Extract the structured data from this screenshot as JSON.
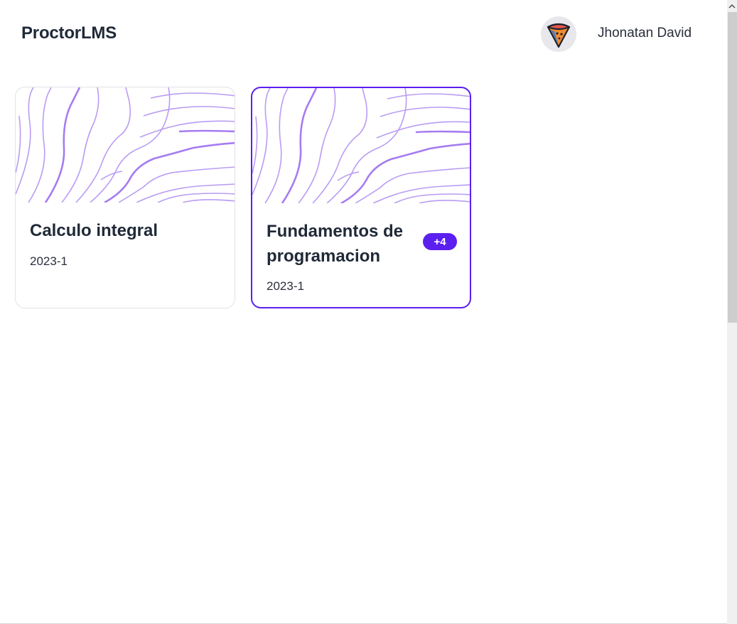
{
  "app": {
    "brand": "ProctorLMS"
  },
  "user": {
    "name": "Jhonatan David",
    "avatar_icon": "pizza-slice-icon"
  },
  "courses": [
    {
      "title": "Calculo integral",
      "term": "2023-1",
      "badge": ""
    },
    {
      "title": "Fundamentos de programacion",
      "term": "2023-1",
      "badge": "+4"
    }
  ],
  "colors": {
    "accent": "#5b1ff0",
    "pattern": "#b99cf3"
  }
}
